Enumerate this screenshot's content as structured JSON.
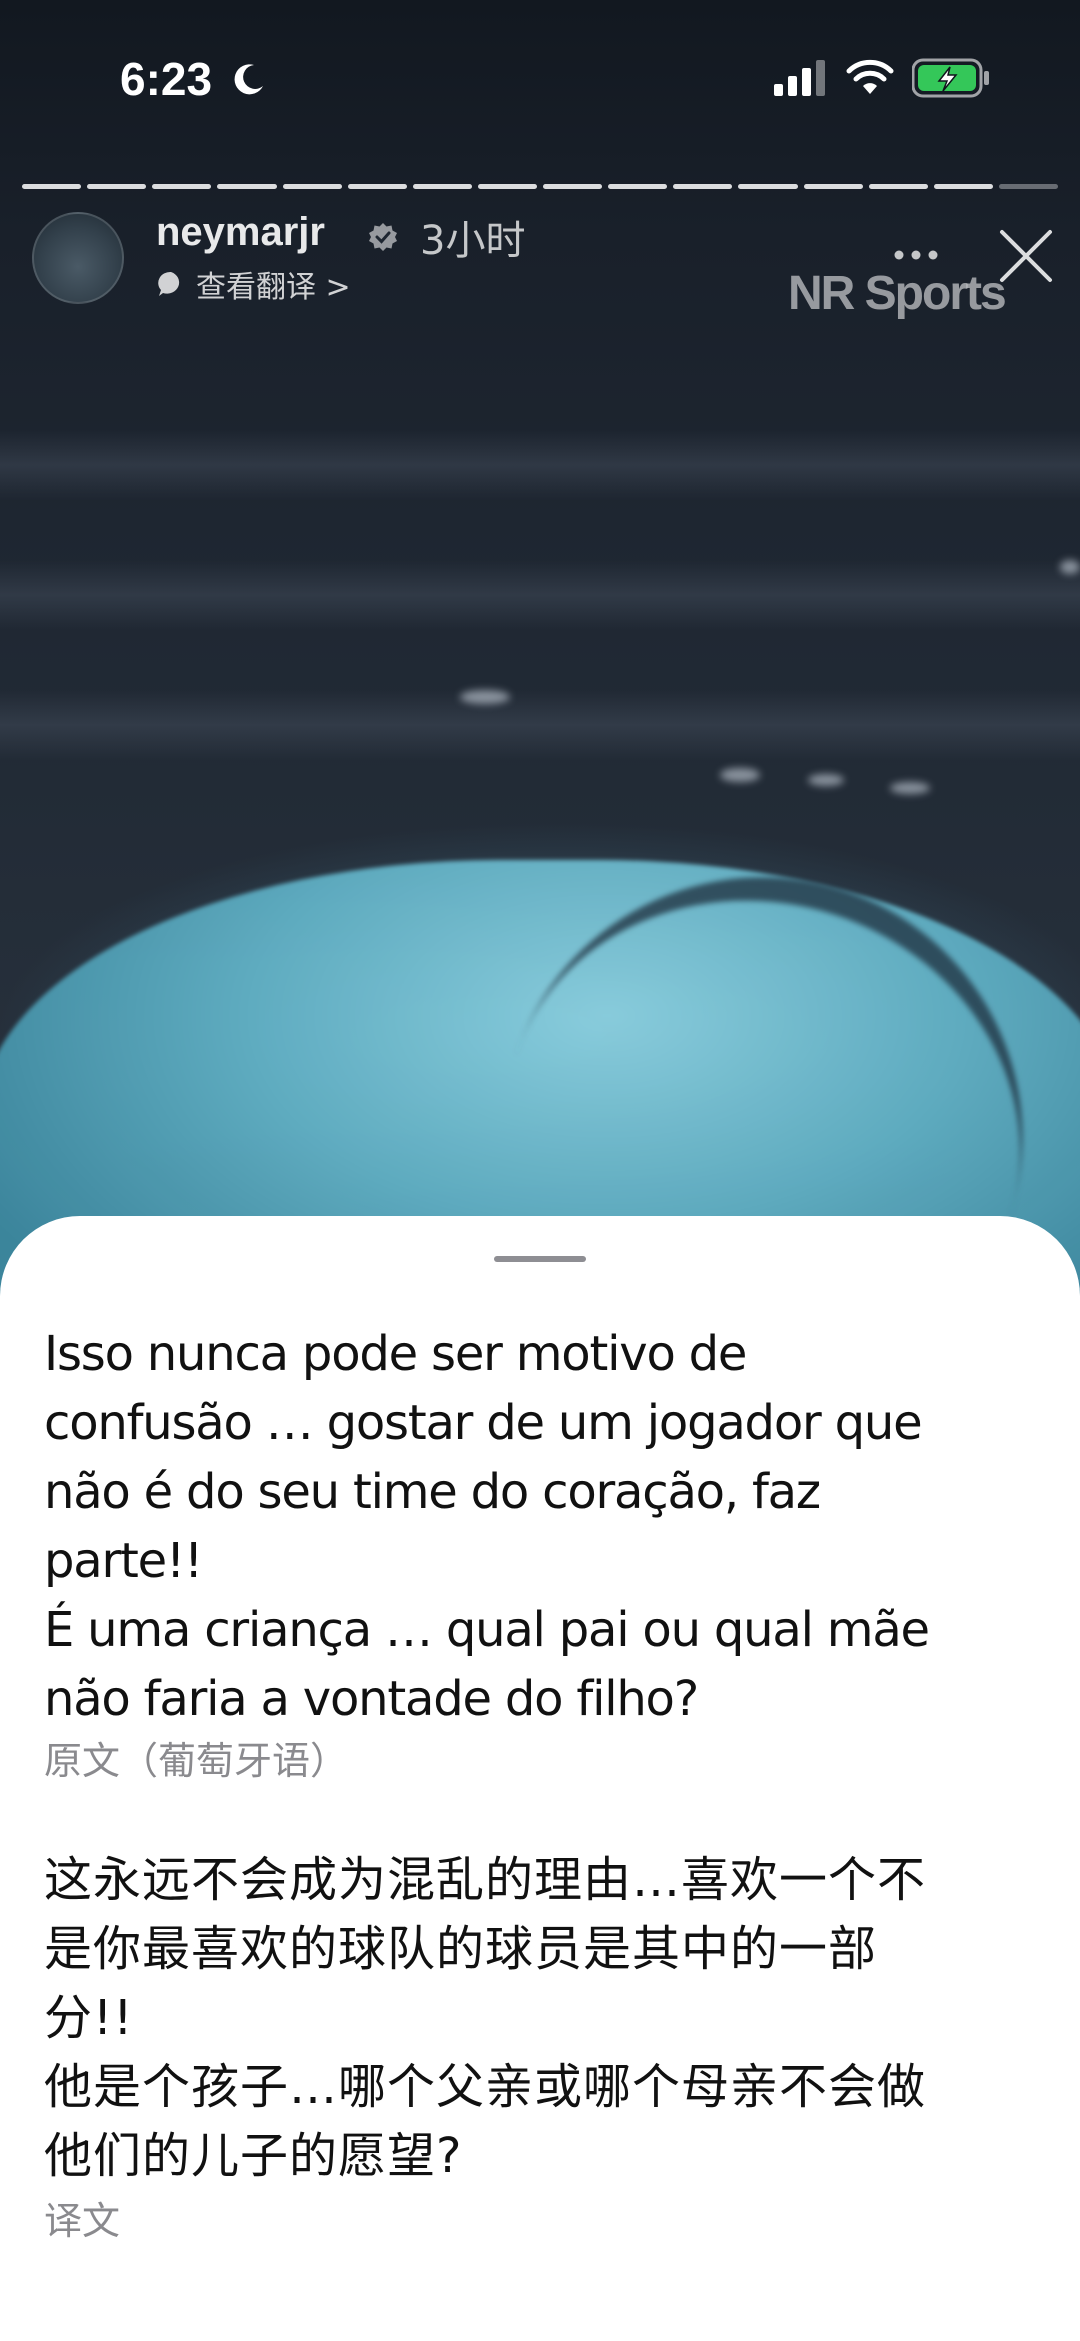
{
  "status_bar": {
    "time": "6:23",
    "icons": [
      "moon-icon",
      "signal-icon",
      "wifi-icon",
      "battery-charging-icon"
    ],
    "battery_color": "#34c759"
  },
  "story": {
    "progress_segments_total": 16,
    "progress_segments_done": 15,
    "username": "neymarjr",
    "verified": true,
    "time_ago": "3小时",
    "translate_link": "查看翻译 >",
    "watermark": "NR Sports"
  },
  "sheet": {
    "original_text": "Isso nunca pode ser motivo de\nconfusão … gostar de um jogador que\nnão é do seu time do coração, faz\nparte!!\nÉ uma criança … qual pai ou qual mãe\nnão faria a vontade do filho?",
    "original_label": "原文（葡萄牙语）",
    "translated_text": "这永远不会成为混乱的理由…喜欢一个不\n是你最喜欢的球队的球员是其中的一部\n分!!\n他是个孩子…哪个父亲或哪个母亲不会做\n他们的儿子的愿望?",
    "translated_label": "译文"
  }
}
